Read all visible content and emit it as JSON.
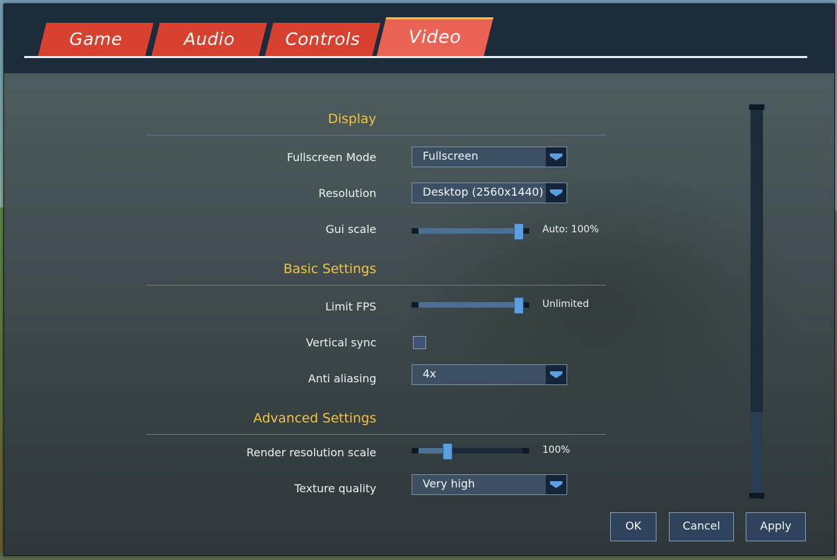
{
  "tabs": [
    {
      "label": "Game"
    },
    {
      "label": "Audio"
    },
    {
      "label": "Controls"
    },
    {
      "label": "Video",
      "active": true
    }
  ],
  "sections": {
    "display": {
      "title": "Display",
      "fullscreen_mode": {
        "label": "Fullscreen Mode",
        "value": "Fullscreen"
      },
      "resolution": {
        "label": "Resolution",
        "value": "Desktop (2560x1440)"
      },
      "gui_scale": {
        "label": "Gui scale",
        "value_text": "Auto: 100%",
        "level": 1.0
      }
    },
    "basic": {
      "title": "Basic Settings",
      "limit_fps": {
        "label": "Limit FPS",
        "value_text": "Unlimited",
        "level": 1.0
      },
      "vertical_sync": {
        "label": "Vertical sync",
        "checked": false
      },
      "anti_aliasing": {
        "label": "Anti aliasing",
        "value": "4x"
      }
    },
    "advanced": {
      "title": "Advanced Settings",
      "render_scale": {
        "label": "Render resolution scale",
        "value_text": "100%",
        "level": 0.25
      },
      "texture_quality": {
        "label": "Texture quality",
        "value": "Very high"
      }
    }
  },
  "buttons": {
    "ok": "OK",
    "cancel": "Cancel",
    "apply": "Apply"
  },
  "colors": {
    "tab": "#d7412f",
    "tab_active": "#ea6354",
    "section_title": "#f0c441",
    "accent": "#5b9fe0"
  }
}
